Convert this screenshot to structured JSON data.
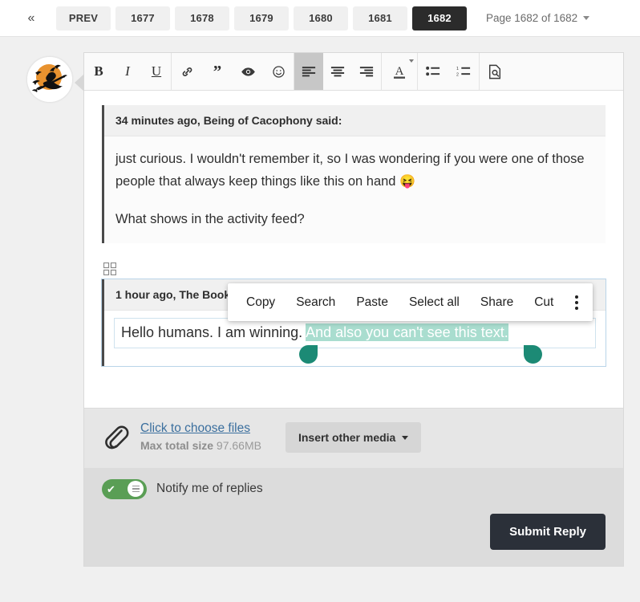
{
  "pagination": {
    "prev_chevron": "«",
    "prev_label": "PREV",
    "pages": [
      "1677",
      "1678",
      "1679",
      "1680",
      "1681",
      "1682"
    ],
    "active_page": "1682",
    "indicator": "Page 1682 of 1682"
  },
  "avatar": {
    "name": "witch-halloween-avatar"
  },
  "toolbar": {
    "groups": [
      {
        "buttons": [
          {
            "name": "bold-button",
            "label": "B",
            "kind": "letter-b",
            "active": false
          },
          {
            "name": "italic-button",
            "label": "I",
            "kind": "letter-i",
            "active": false
          },
          {
            "name": "underline-button",
            "label": "U",
            "kind": "letter-u",
            "active": false
          }
        ]
      },
      {
        "buttons": [
          {
            "name": "link-icon",
            "label": "Link",
            "kind": "link",
            "active": false
          },
          {
            "name": "quote-icon",
            "label": "Quote",
            "kind": "quote",
            "active": false
          },
          {
            "name": "spoiler-eye-icon",
            "label": "Spoiler",
            "kind": "eye",
            "active": false
          },
          {
            "name": "emoji-icon",
            "label": "Emoji",
            "kind": "smiley",
            "active": false
          }
        ]
      },
      {
        "buttons": [
          {
            "name": "align-left-button",
            "label": "Align left",
            "kind": "align-left",
            "active": true
          },
          {
            "name": "align-center-button",
            "label": "Align center",
            "kind": "align-center",
            "active": false
          },
          {
            "name": "align-right-button",
            "label": "Align right",
            "kind": "align-right",
            "active": false
          }
        ]
      },
      {
        "buttons": [
          {
            "name": "text-color-button",
            "label": "A",
            "kind": "text-color",
            "active": false
          }
        ]
      },
      {
        "buttons": [
          {
            "name": "bullet-list-button",
            "label": "Bullet list",
            "kind": "bullet-list",
            "active": false
          },
          {
            "name": "numbered-list-button",
            "label": "Numbered list",
            "kind": "number-list",
            "active": false
          }
        ]
      },
      {
        "buttons": [
          {
            "name": "preview-button",
            "label": "Preview",
            "kind": "preview",
            "active": false
          }
        ]
      }
    ]
  },
  "editor": {
    "quote1": {
      "header": "34 minutes ago, Being of Cacophony said:",
      "paragraph1": "just curious. I wouldn't remember it, so I was wondering if you were one of those people that always keep things like this on hand ",
      "emoji": "😝",
      "paragraph2": "What shows in the activity feed?"
    },
    "quote2": {
      "header": "1 hour ago, The Book",
      "text_plain": "Hello humans. I am winning. ",
      "text_selected": "And also you can't see this text."
    }
  },
  "context_menu": {
    "items": [
      "Copy",
      "Search",
      "Paste",
      "Select all",
      "Share",
      "Cut"
    ],
    "overflow_label": "More options"
  },
  "attachments": {
    "link_label": "Click to choose files",
    "max_prefix": "Max total size ",
    "max_size": "97.66MB",
    "media_button": "Insert other media"
  },
  "footer": {
    "notify_label": "Notify me of replies",
    "notify_on": true,
    "submit_label": "Submit Reply"
  },
  "colors": {
    "accent_selection": "#a9ddcf",
    "accent_handle": "#1c8a75",
    "toggle_on": "#5a9e55",
    "submit_bg": "#2b3039",
    "active_page_bg": "#2b2b2b",
    "link": "#3b6f9e"
  }
}
